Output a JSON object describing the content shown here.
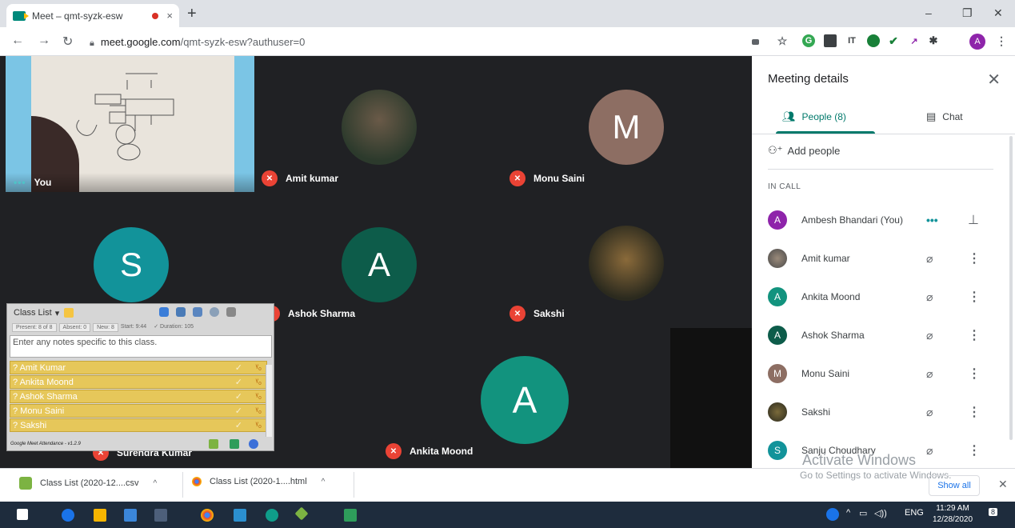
{
  "browser": {
    "tab_title": "Meet – qmt-syzk-esw",
    "tab_close": "×",
    "new_tab": "+",
    "win_min": "–",
    "win_max": "❐",
    "win_close": "✕",
    "url_domain": "meet.google.com",
    "url_path": "/qmt-syzk-esw?authuser=0",
    "profile_initial": "A"
  },
  "stage": {
    "tiles": [
      {
        "name": "You"
      },
      {
        "name": "Amit kumar"
      },
      {
        "name": "Monu Saini",
        "initial": "M",
        "color": "#8d6e63"
      },
      {
        "name": "Ashok Sharma",
        "initial": "A",
        "color": "#0d5c4a"
      },
      {
        "name": "Sakshi"
      },
      {
        "initial": "S",
        "color": "#12939a"
      },
      {
        "name": "Surendra Kumar"
      },
      {
        "name": "Ankita Moond",
        "initial": "A",
        "color": "#12937e"
      }
    ]
  },
  "widget": {
    "title": "Class List",
    "stats": [
      "Present: 8 of 8",
      "Absent: 0",
      "New: 8",
      "Start: 9:44",
      "✓ Duration: 105"
    ],
    "notes_placeholder": "Enter any notes specific to this class.",
    "rows": [
      "? Amit Kumar",
      "? Ankita Moond",
      "? Ashok Sharma",
      "? Monu Saini",
      "? Sakshi"
    ],
    "footer": "Google Meet Attendance - v1.2.9"
  },
  "panel": {
    "title": "Meeting details",
    "tab_people": "People (8)",
    "tab_chat": "Chat",
    "add_people": "Add people",
    "section": "IN CALL",
    "participants": [
      {
        "name": "Ambesh Bhandari (You)",
        "initial": "A",
        "color": "#8e24aa"
      },
      {
        "name": "Amit kumar",
        "initial": "",
        "color": "#6d6d6d"
      },
      {
        "name": "Ankita Moond",
        "initial": "A",
        "color": "#12937e"
      },
      {
        "name": "Ashok Sharma",
        "initial": "A",
        "color": "#0d5c4a"
      },
      {
        "name": "Monu Saini",
        "initial": "M",
        "color": "#8d6e63"
      },
      {
        "name": "Sakshi",
        "initial": "",
        "color": "#2b2a1e"
      },
      {
        "name": "Sanju Choudhary",
        "initial": "S",
        "color": "#12939a"
      }
    ],
    "watermark_title": "Activate Windows",
    "watermark_sub": "Go to Settings to activate Windows."
  },
  "downloads": {
    "items": [
      "Class List (2020-12....csv",
      "Class List (2020-1....html"
    ],
    "show_all": "Show all"
  },
  "taskbar": {
    "lang": "ENG",
    "time": "11:29 AM",
    "date": "12/28/2020",
    "notif_count": "8"
  }
}
